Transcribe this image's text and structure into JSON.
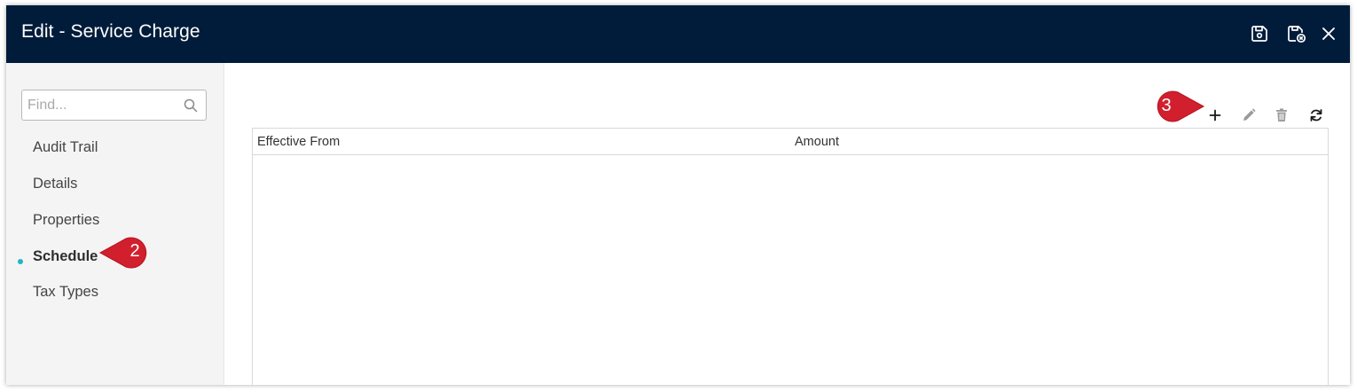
{
  "dialog": {
    "title": "Edit - Service Charge",
    "actions": [
      {
        "name": "save",
        "icon": "save-icon"
      },
      {
        "name": "save-and-close",
        "icon": "save-close-icon"
      },
      {
        "name": "close",
        "icon": "close-icon"
      }
    ]
  },
  "sidebar": {
    "search": {
      "placeholder": "Find...",
      "value": "",
      "icon": "search-icon"
    },
    "items": [
      {
        "label": "Audit Trail",
        "active": false
      },
      {
        "label": "Details",
        "active": false
      },
      {
        "label": "Properties",
        "active": false
      },
      {
        "label": "Schedule",
        "active": true
      },
      {
        "label": "Tax Types",
        "active": false
      }
    ],
    "active_indicator_color": "#1fb5c7"
  },
  "toolbar": {
    "tools": [
      {
        "name": "add",
        "icon": "plus-icon"
      },
      {
        "name": "edit",
        "icon": "pencil-icon"
      },
      {
        "name": "delete",
        "icon": "trash-icon"
      },
      {
        "name": "refresh",
        "icon": "refresh-icon"
      }
    ]
  },
  "grid": {
    "columns": [
      "Effective From",
      "Amount"
    ],
    "rows": []
  },
  "callouts": [
    {
      "number": "2",
      "target": "Schedule"
    },
    {
      "number": "3",
      "target": "add"
    }
  ],
  "colors": {
    "titlebar": "#001c3a",
    "callout": "#d21f2d",
    "sidebar_bg": "#f4f4f4"
  }
}
